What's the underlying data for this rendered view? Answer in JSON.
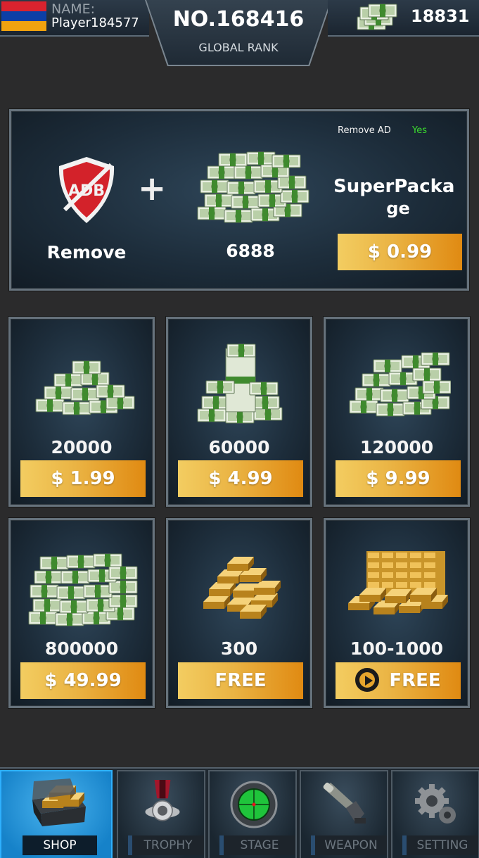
{
  "header": {
    "name_label": "NAME:",
    "player_name": "Player184577",
    "rank_number": "NO.168416",
    "rank_label": "GLOBAL RANK",
    "cash": "18831",
    "flag_colors": [
      "#d9232e",
      "#0d3fa6",
      "#f0a20f"
    ]
  },
  "super_package": {
    "remove_ad_label": "Remove AD",
    "remove_ad_value": "Yes",
    "ad_icon_text": "ADB",
    "remove_label": "Remove",
    "plus": "+",
    "cash_amount": "6888",
    "title_line1": "SuperPacka",
    "title_line2": "ge",
    "price": "$ 0.99"
  },
  "offers": [
    {
      "amount": "20000",
      "price": "$ 1.99",
      "icon": "cash-stack-small"
    },
    {
      "amount": "60000",
      "price": "$ 4.99",
      "icon": "cash-stack-medium"
    },
    {
      "amount": "120000",
      "price": "$ 9.99",
      "icon": "cash-stack-large"
    },
    {
      "amount": "800000",
      "price": "$ 49.99",
      "icon": "cash-pile-huge"
    },
    {
      "amount": "300",
      "price": "FREE",
      "icon": "gold-bars-small"
    },
    {
      "amount": "100-1000",
      "price": "FREE",
      "icon": "gold-bars-large",
      "video_icon": "play-icon"
    }
  ],
  "nav": [
    {
      "label": "SHOP",
      "icon": "treasure-chest-icon",
      "active": true
    },
    {
      "label": "TROPHY",
      "icon": "medal-icon"
    },
    {
      "label": "STAGE",
      "icon": "scope-icon"
    },
    {
      "label": "WEAPON",
      "icon": "weapon-icon"
    },
    {
      "label": "SETTING",
      "icon": "gear-icon"
    }
  ],
  "colors": {
    "button_gold_start": "#f3cd61",
    "button_gold_end": "#e08a12",
    "yes_green": "#3bdc2e",
    "nav_active": "#1a8fd8"
  }
}
